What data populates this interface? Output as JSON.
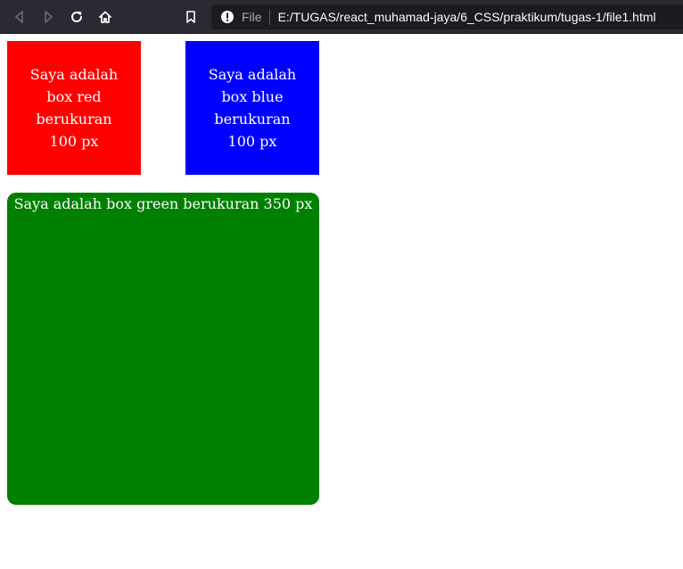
{
  "browser": {
    "scheme_label": "File",
    "url": "E:/TUGAS/react_muhamad-jaya/6_CSS/praktikum/tugas-1/file1.html",
    "icons": {
      "back": "arrow-left-icon",
      "forward": "arrow-right-icon",
      "reload": "reload-icon",
      "home": "home-icon",
      "bookmark": "bookmark-icon",
      "info": "info-icon"
    }
  },
  "page": {
    "boxes": {
      "red": {
        "text": "Saya adalah box red berukuran 100 px",
        "color": "#ff0000"
      },
      "blue": {
        "text": "Saya adalah box blue berukuran 100 px",
        "color": "#0000ff"
      },
      "green": {
        "text": "Saya adalah box green berukuran 350 px",
        "color": "#008000"
      }
    }
  },
  "colors": {
    "toolbar_bg": "#2b2a33",
    "urlbar_bg": "#1c1b22",
    "page_bg": "#ffffff"
  }
}
